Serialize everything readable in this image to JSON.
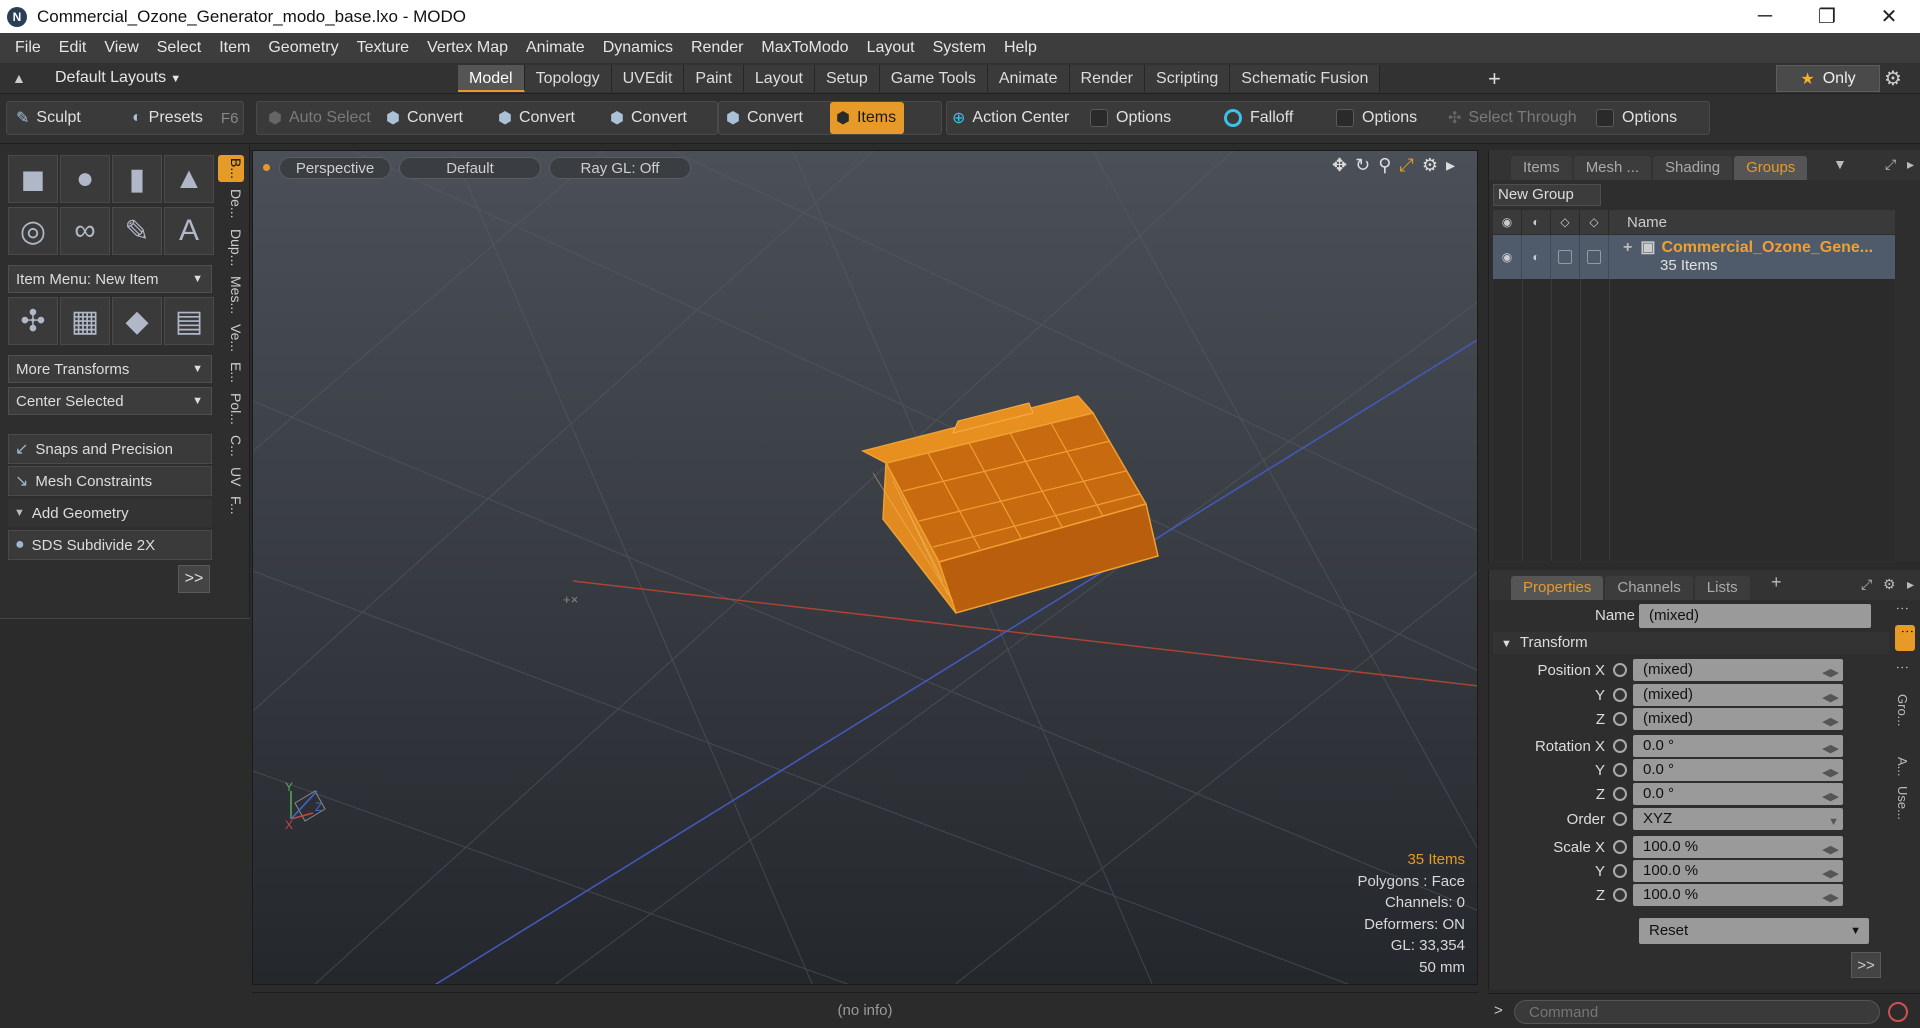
{
  "window": {
    "title": "Commercial_Ozone_Generator_modo_base.lxo - MODO",
    "logo": "N",
    "minimize": "─",
    "maximize": "❐",
    "close": "✕"
  },
  "menu": [
    "File",
    "Edit",
    "View",
    "Select",
    "Item",
    "Geometry",
    "Texture",
    "Vertex Map",
    "Animate",
    "Dynamics",
    "Render",
    "MaxToModo",
    "Layout",
    "System",
    "Help"
  ],
  "layout_bar": {
    "layout_dropdown": "Default Layouts",
    "tabs": [
      "Model",
      "Topology",
      "UVEdit",
      "Paint",
      "Layout",
      "Setup",
      "Game Tools",
      "Animate",
      "Render",
      "Scripting",
      "Schematic Fusion"
    ],
    "active_tab": "Model",
    "only_label": "Only"
  },
  "toolbar": {
    "sculpt": "Sculpt",
    "presets": "Presets",
    "presets_key": "F6",
    "auto_select": "Auto Select",
    "convert1": "Convert",
    "convert2": "Convert",
    "convert3": "Convert",
    "convert4": "Convert",
    "items": "Items",
    "action_center": "Action Center",
    "options1": "Options",
    "falloff": "Falloff",
    "options2": "Options",
    "select_through": "Select Through",
    "options3": "Options"
  },
  "left_panel": {
    "vtabs": [
      "B...",
      "De...",
      "Dup...",
      "Mes...",
      "Ve...",
      "E...",
      "Pol...",
      "C...",
      "UV",
      "F..."
    ],
    "item_menu": "Item Menu: New Item",
    "more_transforms": "More Transforms",
    "center_selected": "Center Selected",
    "snaps": "Snaps and Precision",
    "mesh_constraints": "Mesh Constraints",
    "add_geometry": "Add Geometry",
    "sds": "SDS Subdivide 2X",
    "more": ">>"
  },
  "viewport": {
    "view": "Perspective",
    "shading": "Default",
    "raygl": "Ray GL: Off",
    "info": {
      "items": "35 Items",
      "polygons": "Polygons : Face",
      "channels": "Channels: 0",
      "deformers": "Deformers: ON",
      "gl": "GL: 33,354",
      "scale": "50 mm"
    },
    "status": "(no info)"
  },
  "groups_panel": {
    "tabs": [
      "Items",
      "Mesh ...",
      "Shading",
      "Groups"
    ],
    "active_tab": "Groups",
    "new_group": "New Group",
    "name_col": "Name",
    "row_title": "Commercial_Ozone_Gene...",
    "row_sub": "35 Items"
  },
  "properties": {
    "tabs": [
      "Properties",
      "Channels",
      "Lists"
    ],
    "active_tab": "Properties",
    "name_label": "Name",
    "name_value": "(mixed)",
    "transform": "Transform",
    "rows": [
      {
        "label": "Position X",
        "value": "(mixed)"
      },
      {
        "label": "Y",
        "value": "(mixed)"
      },
      {
        "label": "Z",
        "value": "(mixed)"
      },
      {
        "label": "Rotation X",
        "value": "0.0 °"
      },
      {
        "label": "Y",
        "value": "0.0 °"
      },
      {
        "label": "Z",
        "value": "0.0 °"
      },
      {
        "label": "Order",
        "value": "XYZ"
      },
      {
        "label": "Scale X",
        "value": "100.0 %"
      },
      {
        "label": "Y",
        "value": "100.0 %"
      },
      {
        "label": "Z",
        "value": "100.0 %"
      }
    ],
    "reset": "Reset",
    "more": ">>",
    "vtabs": [
      "Gro...",
      "A...",
      "Use..."
    ]
  },
  "command": {
    "arrow": ">",
    "placeholder": "Command"
  },
  "colors": {
    "accent": "#e69a28",
    "selection": "#4f5b6b"
  }
}
